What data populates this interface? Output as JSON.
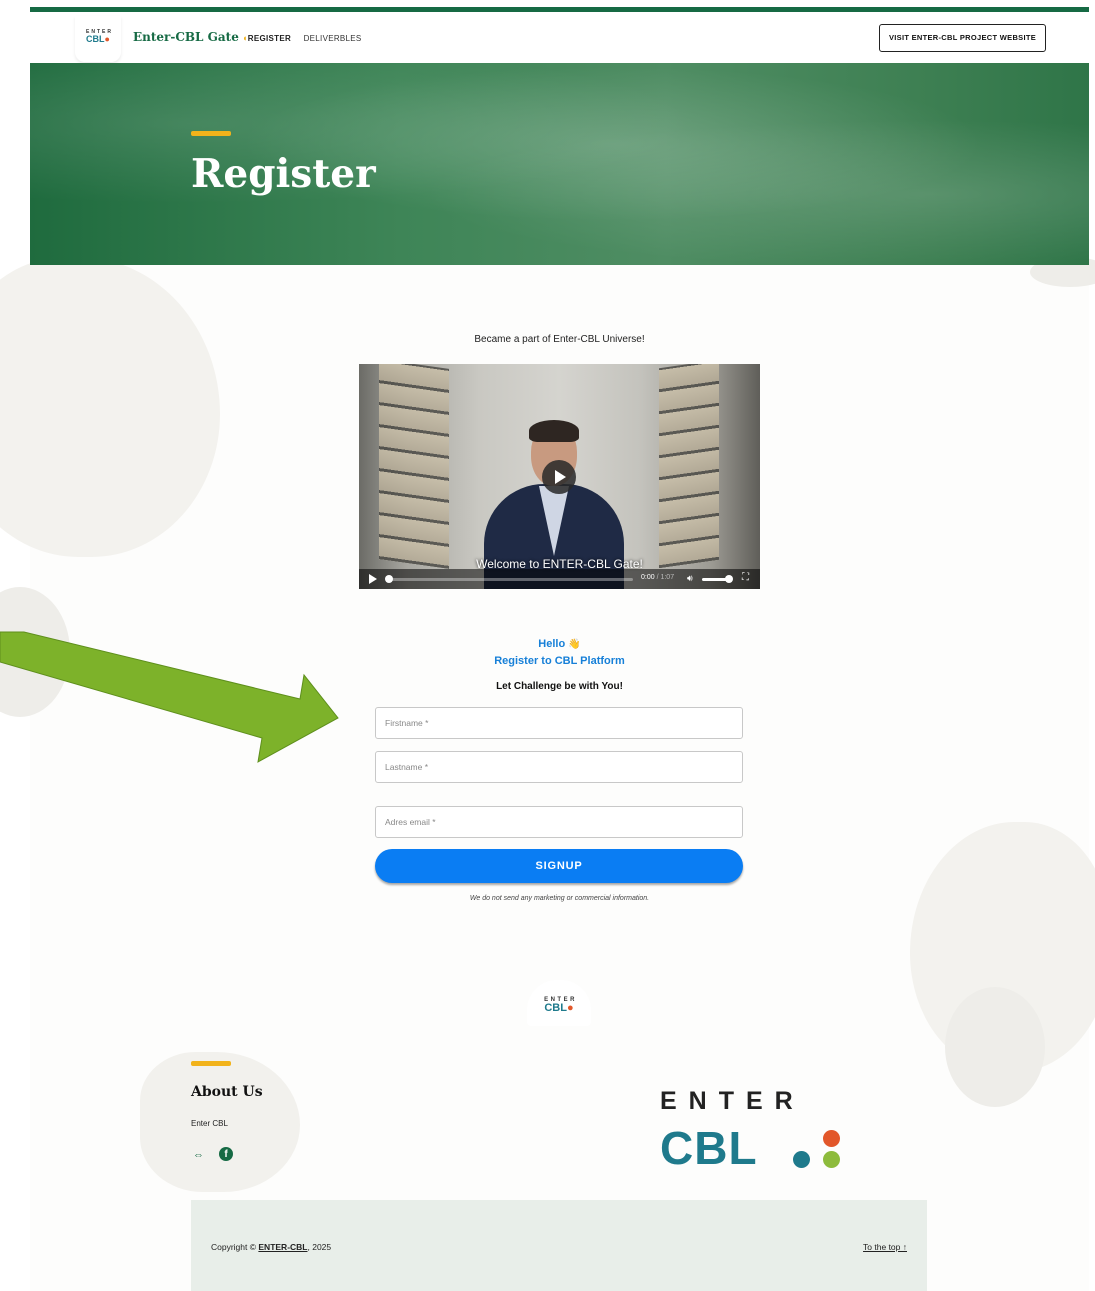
{
  "header": {
    "logo": {
      "enter": "ENTER",
      "cbl": "CBL",
      "dots": "●"
    },
    "site_title": "Enter-CBL Gate",
    "nav": [
      {
        "label": "REGISTER",
        "icon": "moon-icon"
      },
      {
        "label": "DELIVERBLES"
      }
    ],
    "visit_button": "VISIT ENTER-CBL PROJECT WEBSITE"
  },
  "hero": {
    "title": "Register"
  },
  "main": {
    "intro": "Became a part of Enter-CBL Universe!",
    "video": {
      "caption": "Welcome to ENTER-CBL Gate!",
      "current_time": "0:00",
      "duration": "1:07",
      "progress": 0
    },
    "greeting": "Hello",
    "greeting_icon": "👋",
    "register_heading": "Register to CBL Platform",
    "tagline": "Let Challenge be with You!",
    "form": {
      "firstname_placeholder": "Firstname *",
      "lastname_placeholder": "Lastname *",
      "email_placeholder": "Adres email *",
      "submit_label": "SIGNUP"
    },
    "disclaimer": "We do not send any marketing or commercial information."
  },
  "footer_logo": {
    "enter": "ENTER",
    "cbl": "CBL"
  },
  "footer": {
    "about_title": "About Us",
    "about_text": "Enter CBL",
    "big_logo": {
      "enter": "ENTER",
      "cbl": "CBL"
    },
    "copyright_prefix": "Copyright ©",
    "copyright_brand": "ENTER-CBL",
    "copyright_year": ", 2025",
    "to_top": "To the top ↑"
  },
  "colors": {
    "brand_green": "#166a44",
    "accent_yellow": "#f2b31b",
    "link_blue": "#1780d8",
    "button_blue": "#0a7df3",
    "logo_teal": "#1f7a8c",
    "logo_red": "#e2572a",
    "logo_green": "#8dbb3c",
    "annotation_arrow": "#7db22a"
  }
}
